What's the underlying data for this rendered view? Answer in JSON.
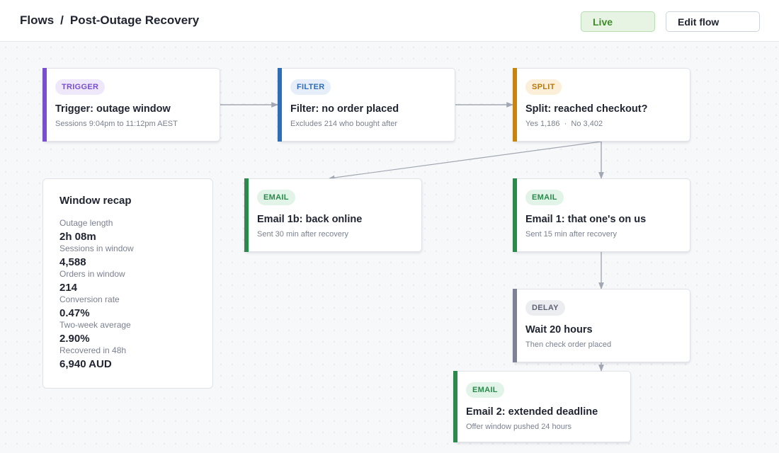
{
  "header": {
    "breadcrumb_root": "Flows",
    "breadcrumb_separator": "/",
    "breadcrumb_current": "Post-Outage Recovery",
    "live_label": "Live",
    "edit_label": "Edit flow"
  },
  "colors": {
    "trigger": "#7a4fcf",
    "filter": "#2f6db5",
    "split": "#c78510",
    "email": "#2a8a4c",
    "delay": "#7d8394",
    "live": "#3f8a2c"
  },
  "nodes": [
    {
      "id": "trigger",
      "tag": "TRIGGER",
      "title": "Trigger: outage window",
      "subtitle": "Sessions 9:04pm to 11:12pm AEST"
    },
    {
      "id": "filter",
      "tag": "FILTER",
      "title": "Filter: no order placed",
      "subtitle": "Excludes 214 who bought after"
    },
    {
      "id": "split",
      "tag": "SPLIT",
      "title": "Split: reached checkout?",
      "subtitle": "Yes 1,186  ·  No 3,402"
    },
    {
      "id": "email1b",
      "tag": "EMAIL",
      "title": "Email 1b: back online",
      "subtitle": "Sent 30 min after recovery"
    },
    {
      "id": "email1",
      "tag": "EMAIL",
      "title": "Email 1: that one's on us",
      "subtitle": "Sent 15 min after recovery"
    },
    {
      "id": "delay",
      "tag": "DELAY",
      "title": "Wait 20 hours",
      "subtitle": "Then check order placed"
    },
    {
      "id": "email2",
      "tag": "EMAIL",
      "title": "Email 2: extended deadline",
      "subtitle": "Offer window pushed 24 hours"
    }
  ],
  "recap": {
    "title": "Window recap",
    "stats": [
      {
        "label": "Outage length",
        "value": "2h 08m"
      },
      {
        "label": "Sessions in window",
        "value": "4,588"
      },
      {
        "label": "Orders in window",
        "value": "214"
      },
      {
        "label": "Conversion rate",
        "value": "0.47%"
      },
      {
        "label": "Two-week average",
        "value": "2.90%"
      },
      {
        "label": "Recovered in 48h",
        "value": "6,940 AUD"
      }
    ]
  }
}
